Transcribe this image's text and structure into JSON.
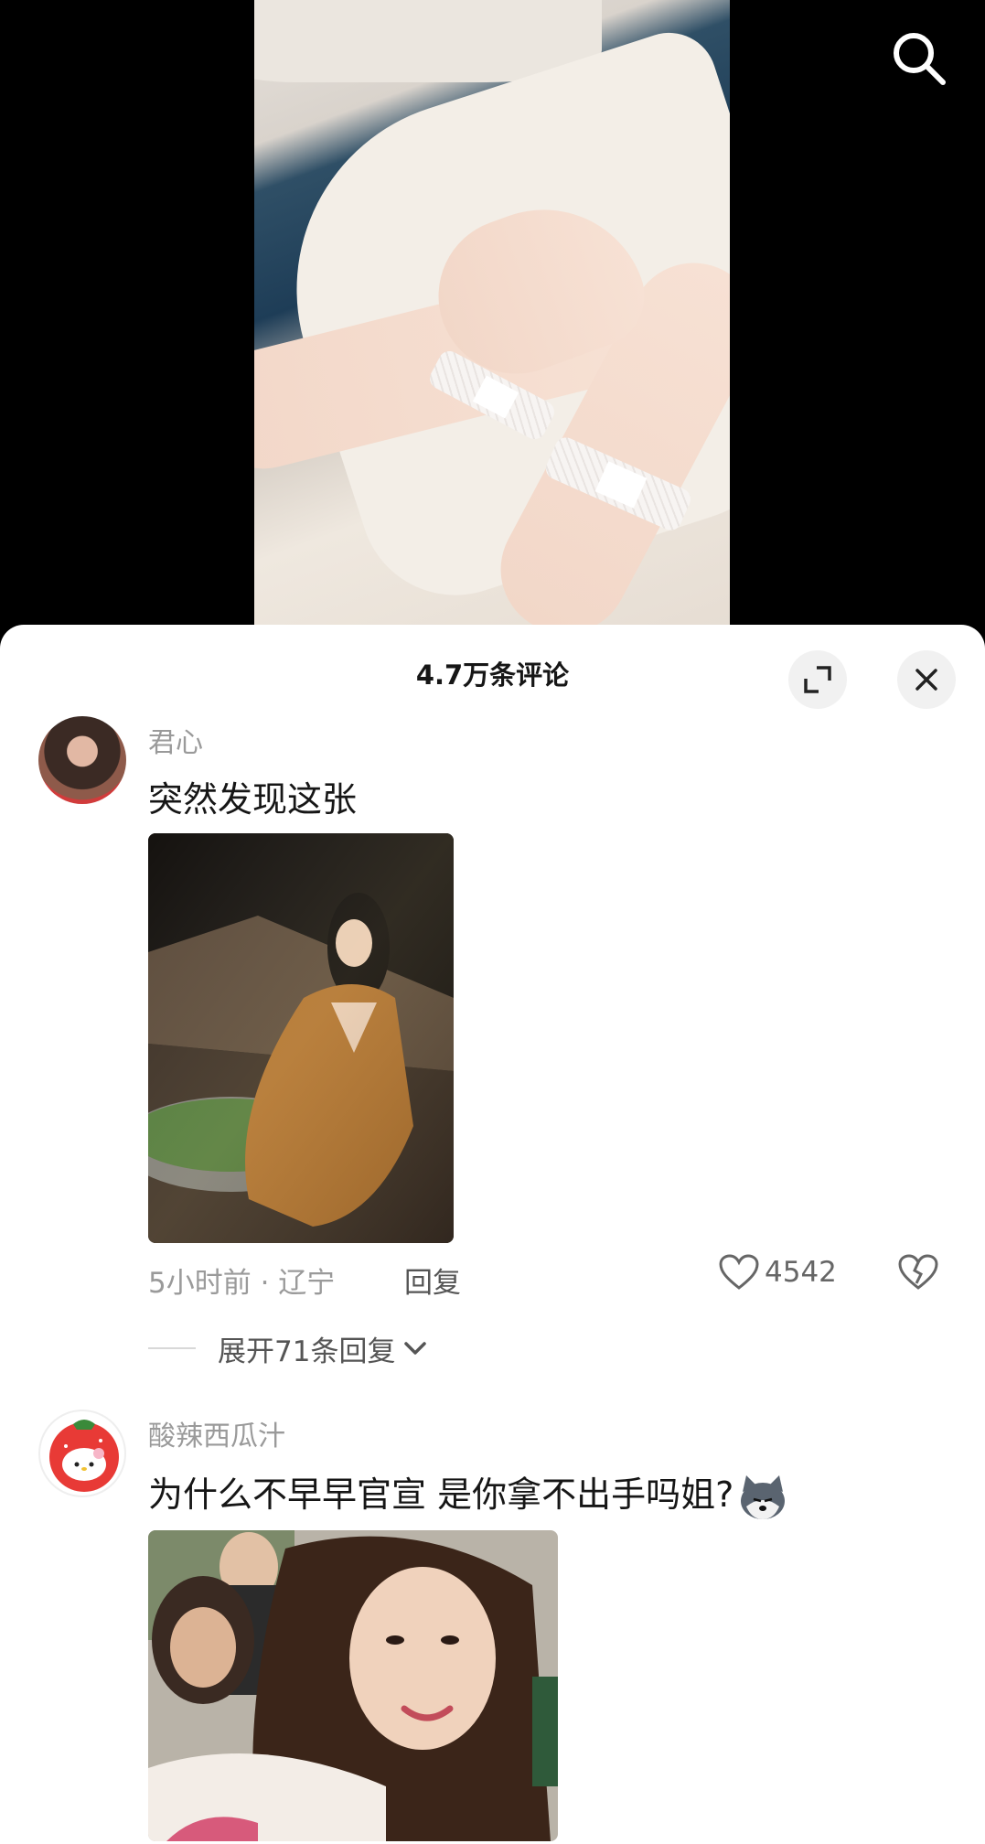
{
  "header": {
    "search_icon": "search-icon"
  },
  "comments_panel": {
    "title": "4.7万条评论",
    "expand_icon": "expand-icon",
    "close_icon": "close-icon"
  },
  "comments": [
    {
      "username": "君心",
      "text": "突然发现这张",
      "time_location": "5小时前 · 辽宁",
      "reply_label": "回复",
      "like_count": "4542",
      "expand_replies_label": "展开71条回复"
    },
    {
      "username": "酸辣西瓜汁",
      "text": "为什么不早早官宣 是你拿不出手吗姐?",
      "emoji": "husky-emoji"
    }
  ],
  "colors": {
    "sheet_background": "#ffffff",
    "secondary_text": "#9a9a9a",
    "primary_text": "#161616"
  }
}
